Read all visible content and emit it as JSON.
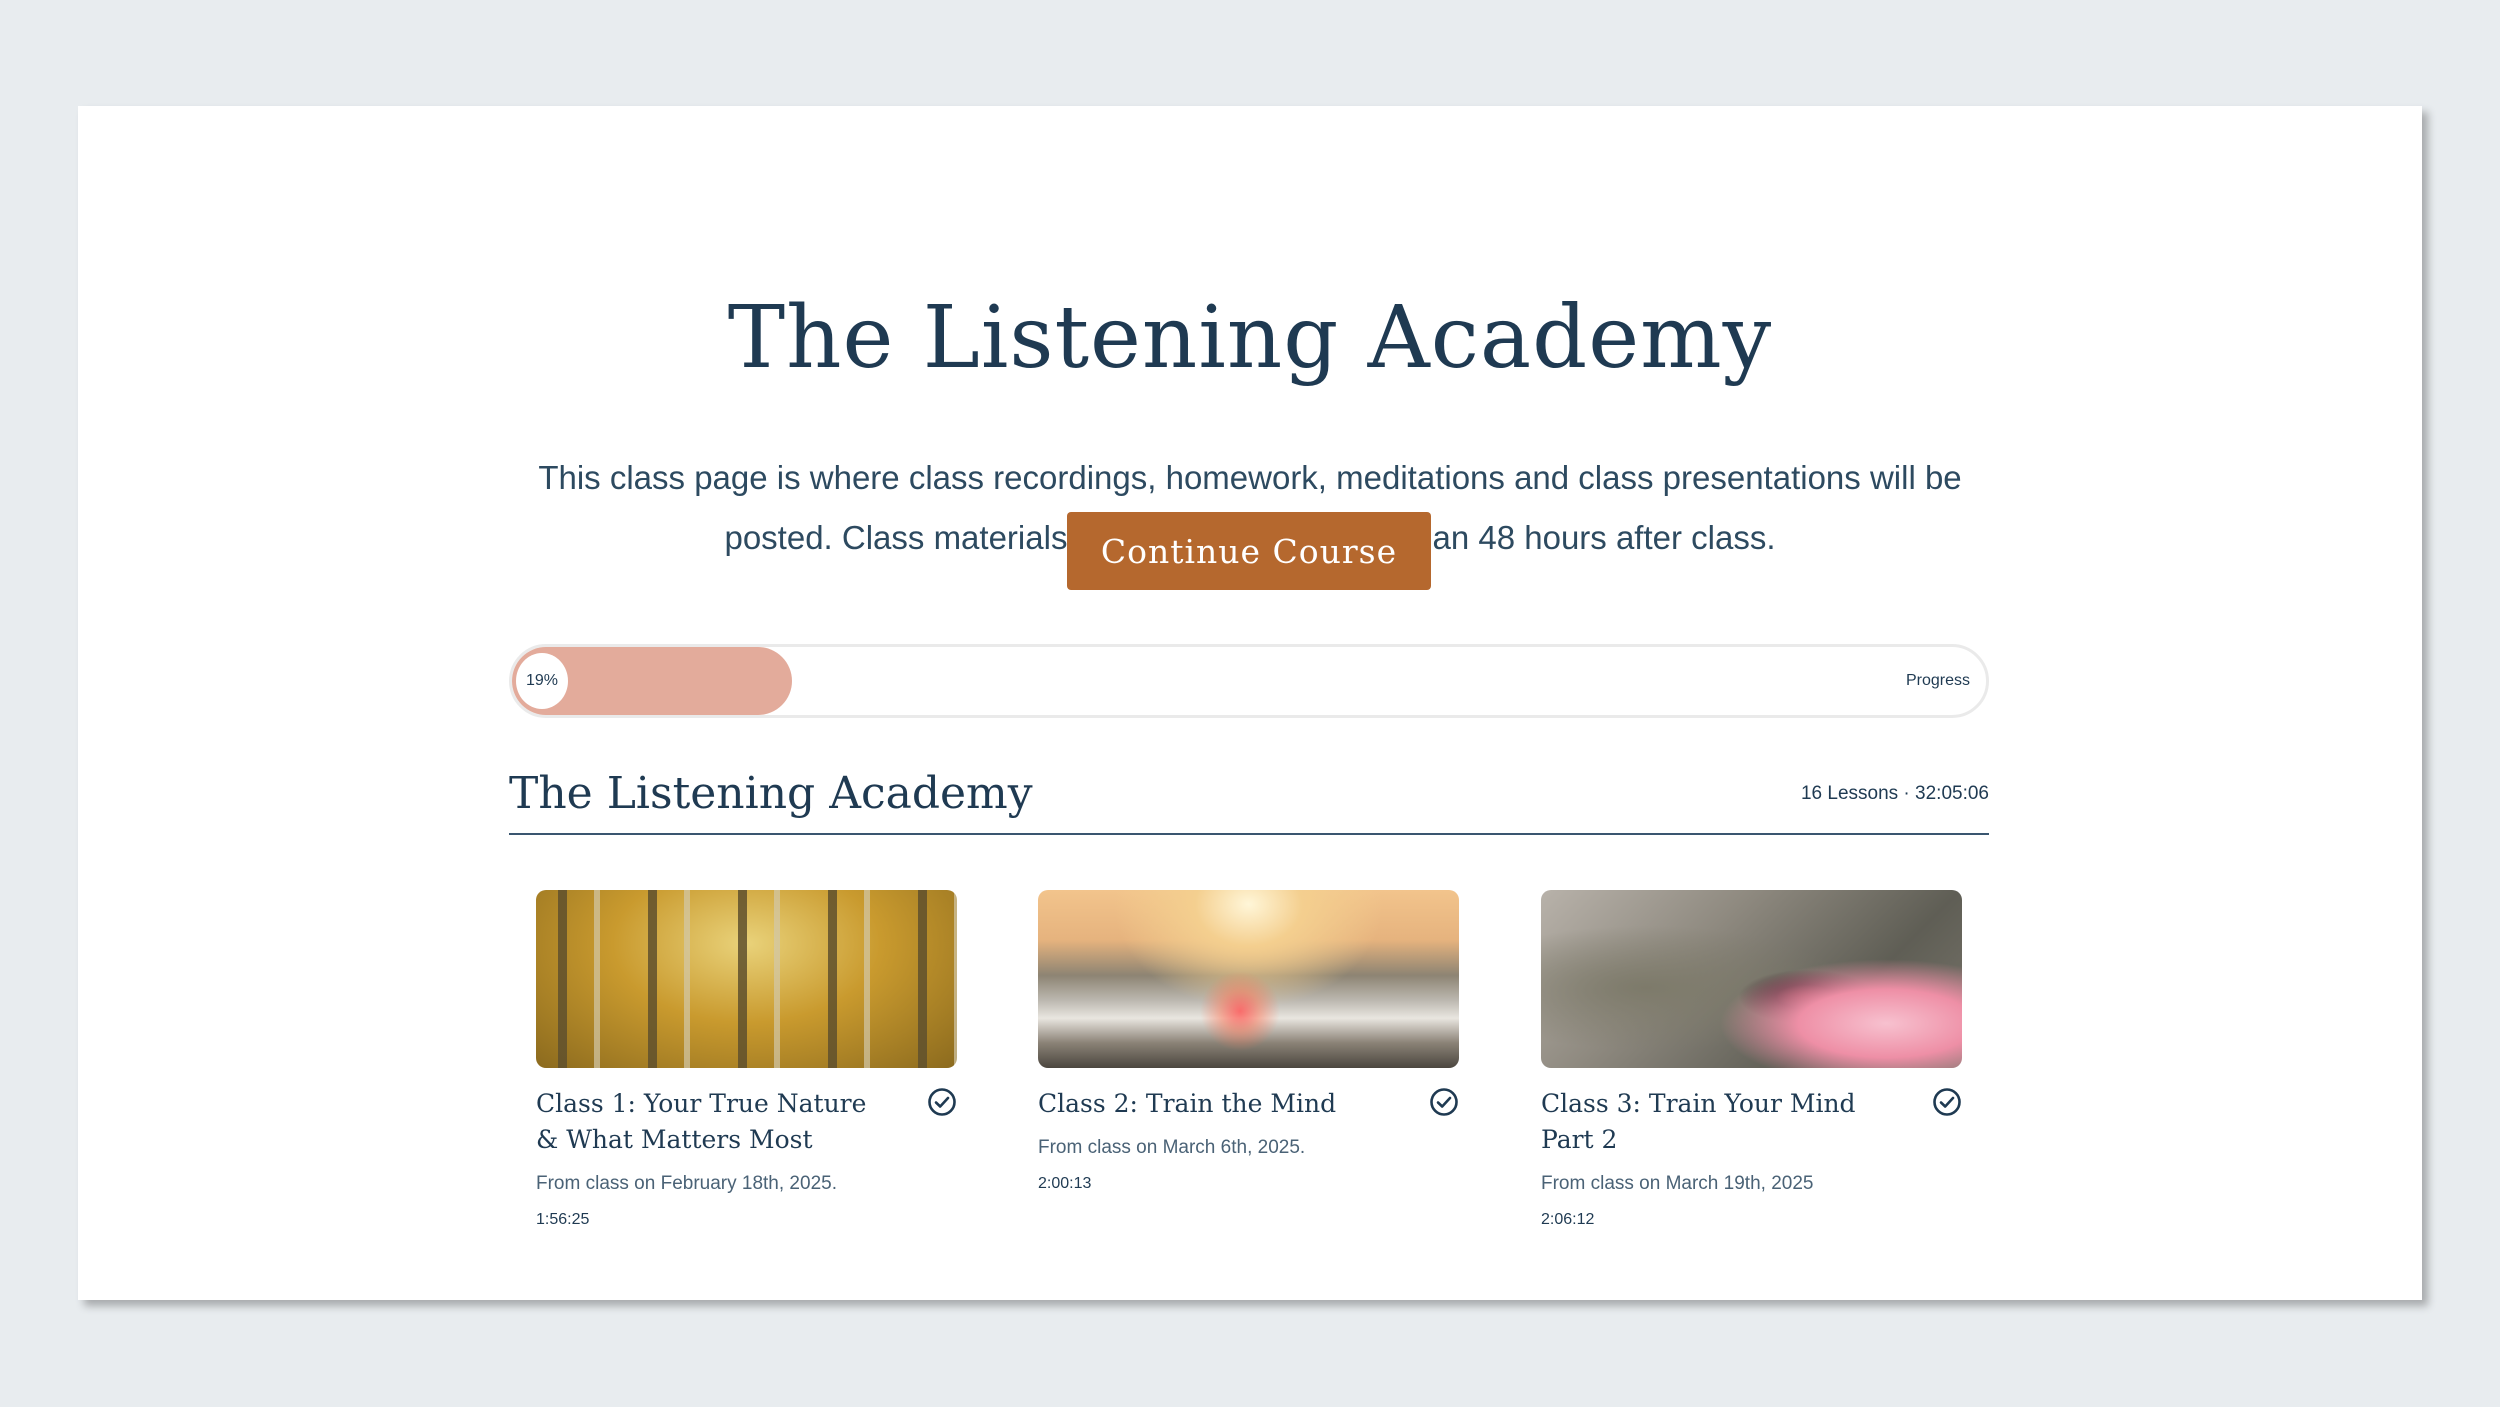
{
  "page": {
    "title": "The Listening Academy",
    "description": "This class page is where class recordings, homework, meditations and class presentations will be posted. Class materials will be posted no later than 48 hours after class.",
    "continue_label": "Continue Course"
  },
  "progress": {
    "percent": 19,
    "percent_label": "19%",
    "label": "Progress"
  },
  "section": {
    "title": "The Listening Academy",
    "meta": "16 Lessons · 32:05:06"
  },
  "lessons": [
    {
      "title": "Class 1: Your True Nature & What Matters Most",
      "description": "From class on February 18th, 2025.",
      "duration": "1:56:25",
      "image": "aspen-forest",
      "completed": true
    },
    {
      "title": "Class 2: Train the Mind",
      "description": "From class on March 6th, 2025.",
      "duration": "2:00:13",
      "image": "ocean-sunset-waves",
      "completed": true
    },
    {
      "title": "Class 3: Train Your Mind Part 2",
      "description": "From class on March 19th, 2025",
      "duration": "2:06:12",
      "image": "hummingbird-flower",
      "completed": true
    }
  ],
  "colors": {
    "background": "#e8ecef",
    "primary_text": "#1f3a52",
    "accent_button": "#b5682e",
    "progress_fill": "#e3ab9b"
  }
}
